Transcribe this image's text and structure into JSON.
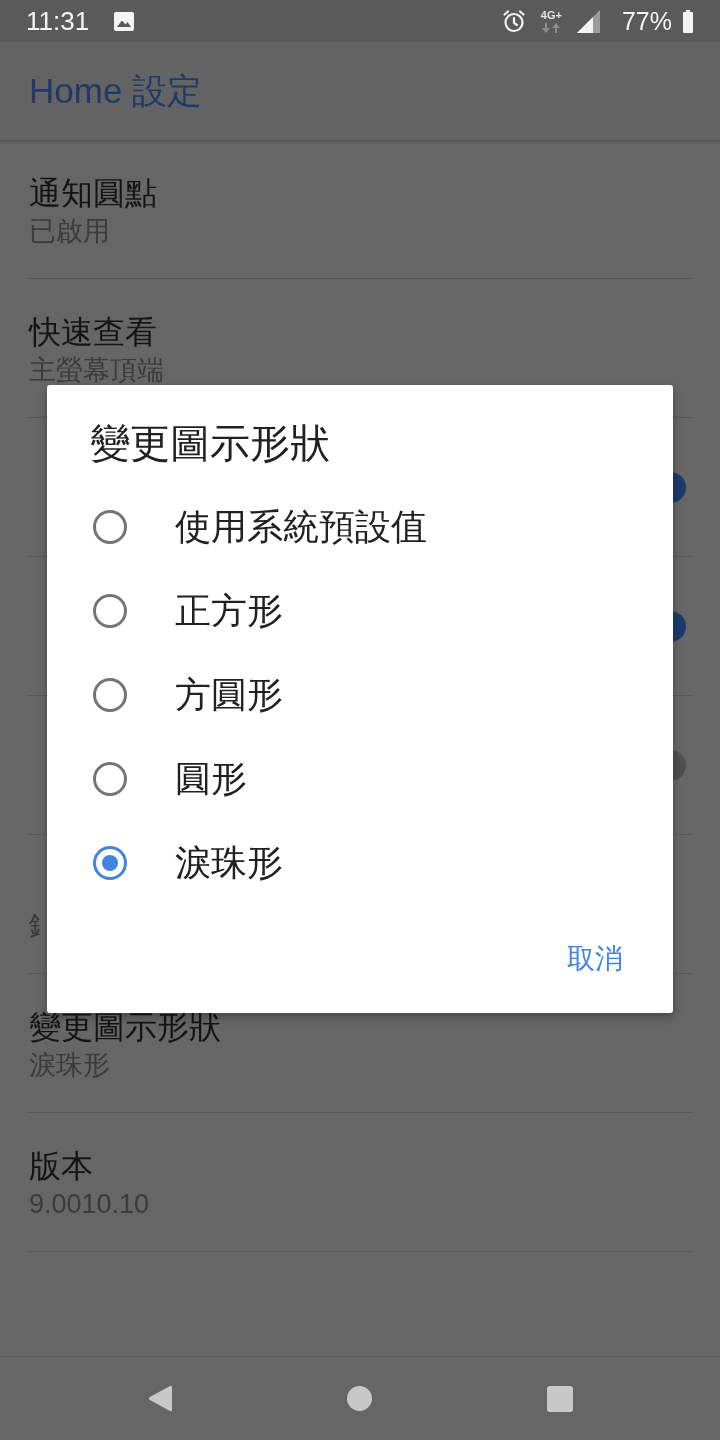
{
  "status_bar": {
    "time": "11:31",
    "network": "4G+",
    "battery": "77%"
  },
  "app_bar": {
    "title": "Home 設定"
  },
  "settings": [
    {
      "kind": "text",
      "title": "通知圓點",
      "subtitle": "已啟用",
      "disabled": false
    },
    {
      "kind": "text",
      "title": "快速查看",
      "subtitle": "主螢幕頂端",
      "disabled": false
    },
    {
      "kind": "switch",
      "disabled": false,
      "on": true
    },
    {
      "kind": "switch",
      "disabled": false,
      "on": true
    },
    {
      "kind": "switch",
      "disabled": true,
      "on": true
    },
    {
      "kind": "text",
      "subtitle": "釒",
      "disabled": false
    },
    {
      "kind": "text",
      "title": "變更圖示形狀",
      "subtitle": "淚珠形",
      "disabled": false
    },
    {
      "kind": "text",
      "title": "版本",
      "subtitle": "9.0010.10",
      "disabled": false
    }
  ],
  "dialog": {
    "title": "變更圖示形狀",
    "options": [
      {
        "label": "使用系統預設值",
        "selected": false
      },
      {
        "label": "正方形",
        "selected": false
      },
      {
        "label": "方圓形",
        "selected": false
      },
      {
        "label": "圓形",
        "selected": false
      },
      {
        "label": "淚珠形",
        "selected": true
      }
    ],
    "cancel_button": "取消"
  }
}
